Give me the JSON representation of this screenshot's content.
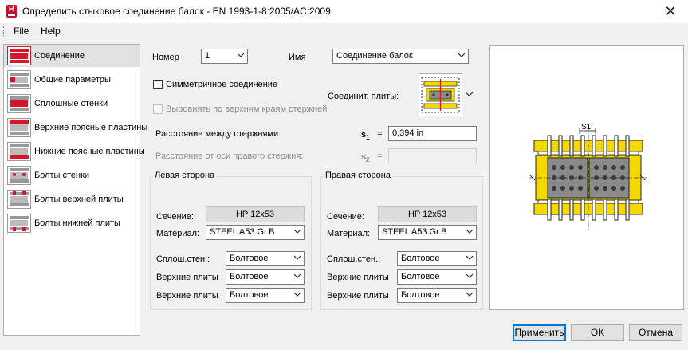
{
  "window": {
    "title": "Определить стыковое соединение балок - EN 1993-1-8:2005/AC:2009"
  },
  "menu": {
    "file": "File",
    "help": "Help"
  },
  "sidebar": {
    "items": [
      {
        "label": "Соединение"
      },
      {
        "label": "Общие параметры"
      },
      {
        "label": "Сплошные стенки"
      },
      {
        "label": "Верхние поясные пластины"
      },
      {
        "label": "Нижние поясные пластины"
      },
      {
        "label": "Болты стенки"
      },
      {
        "label": "Болты верхней плиты"
      },
      {
        "label": "Болты нижней плиты"
      }
    ]
  },
  "form": {
    "number_label": "Номер",
    "number_value": "1",
    "name_label": "Имя",
    "name_value": "Соединение балок",
    "symmetric_label": "Симметричное соединение",
    "align_label": "Выровнять по верхним краям стержней",
    "plates_label": "Соединит. плиты:",
    "distance_label": "Расстояние между стержнями:",
    "s1_symbol": "s",
    "s1_sub": "1",
    "eq": "=",
    "s1_value": "0,394 in",
    "offset_label": "Расстояние от оси правого стержня:",
    "s2_symbol": "s",
    "s2_sub": "2",
    "s2_value": ""
  },
  "left_side": {
    "title": "Левая сторона",
    "section_label": "Сечение:",
    "section_value": "HP 12x53",
    "material_label": "Материал:",
    "material_value": "STEEL A53 Gr.B",
    "web_label": "Сплош.стен.:",
    "web_value": "Болтовое",
    "top_label": "Верхние плиты",
    "top_value": "Болтовое",
    "bottom_label": "Верхние плиты",
    "bottom_value": "Болтовое"
  },
  "right_side": {
    "title": "Правая сторона",
    "section_label": "Сечение:",
    "section_value": "HP 12x53",
    "material_label": "Материал:",
    "material_value": "STEEL A53 Gr.B",
    "web_label": "Сплош.стен.:",
    "web_value": "Болтовое",
    "top_label": "Верхние плиты",
    "top_value": "Болтовое",
    "bottom_label": "Верхние плиты",
    "bottom_value": "Болтовое"
  },
  "preview": {
    "dim_label": "S1"
  },
  "buttons": {
    "apply": "Применить",
    "ok": "OK",
    "cancel": "Отмена"
  },
  "colors": {
    "plate_yellow": "#f5d800",
    "beam_gray": "#8a8a8a",
    "highlight_red": "#d6142a",
    "bolt_dark": "#3a3a3a"
  }
}
